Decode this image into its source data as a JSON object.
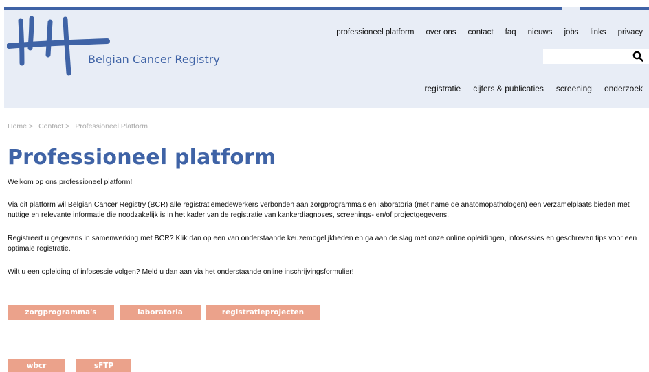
{
  "header": {
    "logo_text": "Belgian Cancer Registry",
    "brand_color": "#3f63a6",
    "top_nav": [
      "professioneel platform",
      "over ons",
      "contact",
      "faq",
      "nieuws",
      "jobs",
      "links",
      "privacy"
    ],
    "search": {
      "placeholder": "",
      "value": "",
      "icon": "search-icon"
    },
    "main_nav": [
      "registratie",
      "cijfers & publicaties",
      "screening",
      "onderzoek"
    ]
  },
  "breadcrumb": [
    "Home",
    "Contact",
    "Professioneel Platform"
  ],
  "main": {
    "title": "Professioneel platform",
    "paragraphs": [
      "Welkom op ons professioneel platform!",
      "Via dit platform wil Belgian Cancer Registry (BCR) alle registratiemedewerkers verbonden aan zorgprogramma's en laboratoria (met name de anatomopathologen) een verzamelplaats bieden met nuttige en relevante informatie die noodzakelijk is in het kader van de registratie van kankerdiagnoses, screenings- en/of projectgegevens.",
      "Registreert u gegevens in samenwerking met BCR? Klik dan op een van onderstaande keuzemogelijkheden en ga aan de slag met onze online opleidingen, infosessies en geschreven tips voor een optimale registratie.",
      "Wilt u een opleiding of infosessie volgen? Meld u dan aan via het onderstaande online inschrijvingsformulier!"
    ],
    "buttons": [
      "zorgprogramma's",
      "laboratoria",
      "registratieprojecten",
      "wbcr",
      "sFTP"
    ],
    "button_color": "#eba28b"
  }
}
